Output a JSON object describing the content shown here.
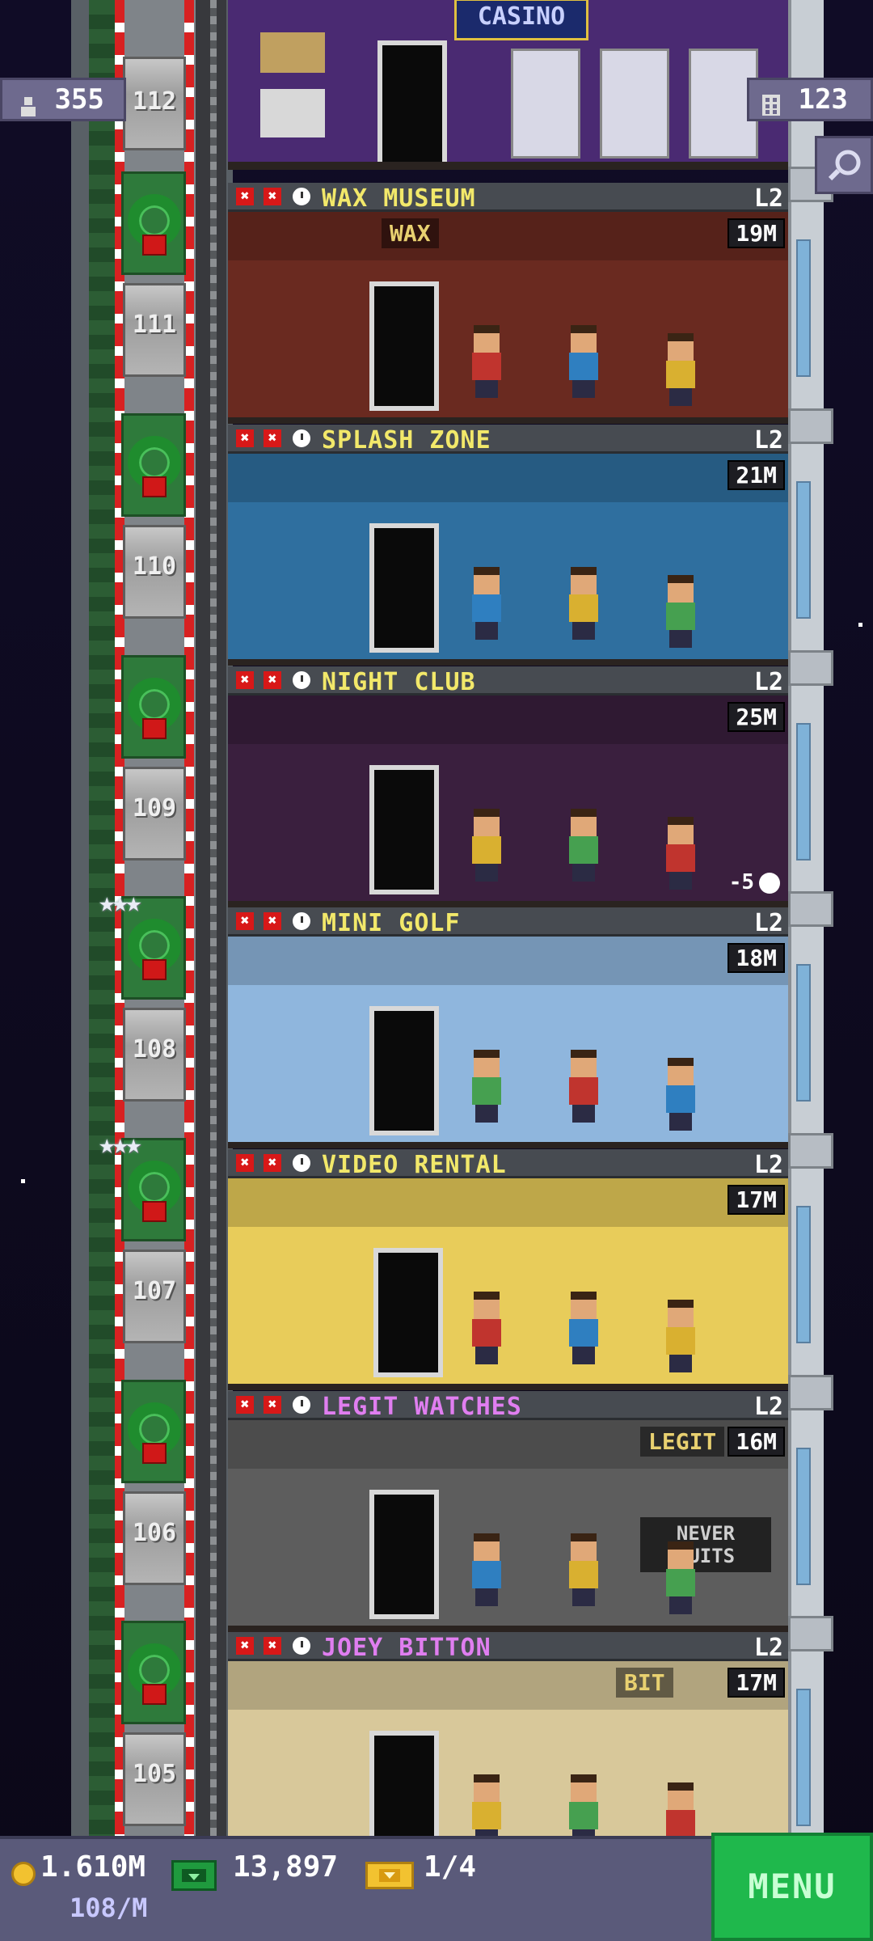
{
  "hud": {
    "population": "355",
    "floors": "123"
  },
  "bottom": {
    "coins": "1.610M",
    "coin_rate": "108/M",
    "bux": "13,897",
    "tickets": "1/4",
    "menu_label": "MENU"
  },
  "top_floor": {
    "number": "112",
    "sign": "CASINO"
  },
  "floors": [
    {
      "number": "111",
      "name": "WAX MUSEUM",
      "level": "L2",
      "price": "19M",
      "sign": "WAX",
      "name_color": "#f2e86a",
      "room_color": "#6a2a20"
    },
    {
      "number": "110",
      "name": "SPLASH ZONE",
      "level": "L2",
      "price": "21M",
      "name_color": "#f2e86a",
      "room_color": "#2f6f9f"
    },
    {
      "number": "109",
      "name": "NIGHT CLUB",
      "level": "L2",
      "price": "25M",
      "timer": "-5",
      "name_color": "#f2e86a",
      "room_color": "#3a1f3e"
    },
    {
      "number": "108",
      "name": "MINI GOLF",
      "level": "L2",
      "price": "18M",
      "name_color": "#f2e86a",
      "room_color": "#8fb6dd"
    },
    {
      "number": "107",
      "name": "VIDEO RENTAL",
      "level": "L2",
      "price": "17M",
      "name_color": "#f2e86a",
      "room_color": "#e8cc5a"
    },
    {
      "number": "106",
      "name": "LEGIT WATCHES",
      "level": "L2",
      "price": "16M",
      "sign": "LEGIT",
      "sign2": "NEVER QUITS",
      "name_color": "#e07ef0",
      "room_color": "#5d5d5d"
    },
    {
      "number": "105",
      "name": "JOEY BITTON",
      "level": "L2",
      "price": "17M",
      "sign": "BIT",
      "name_color": "#e07ef0",
      "room_color": "#d8c89a"
    }
  ],
  "colors": {
    "menu_green": "#1fb84c",
    "hud_chip": "#6e6a8e",
    "bottom_bar": "#5a5a7a"
  }
}
